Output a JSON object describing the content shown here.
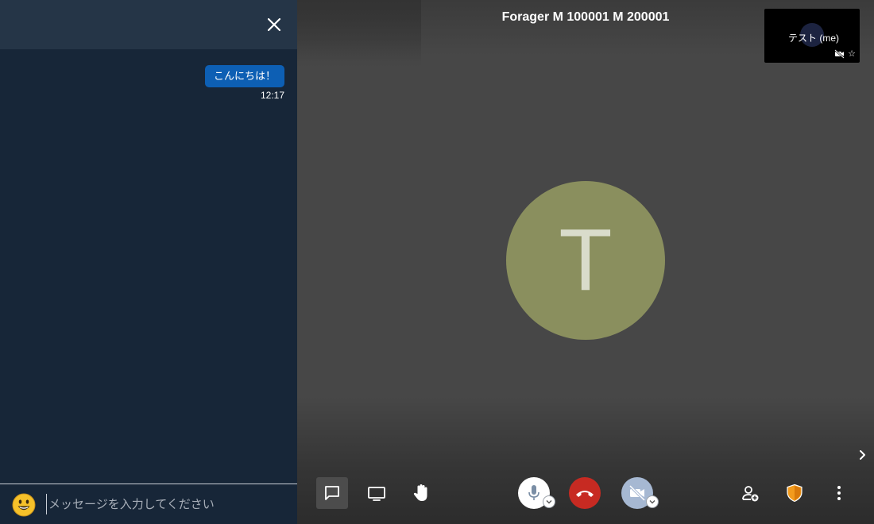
{
  "chat": {
    "messages": [
      {
        "text": "こんにちは！",
        "time": "12:17"
      }
    ],
    "input_placeholder": "メッセージを入力してください"
  },
  "stage": {
    "meeting_title": "Forager M 100001 M 200001",
    "participant_initial": "T",
    "self_view_name": "テスト (me)"
  },
  "colors": {
    "chat_bg": "#172638",
    "chat_header_bg": "#253547",
    "bubble_bg": "#0d5fb4",
    "avatar_bg": "#8a8f5e",
    "hangup_red": "#c72a22",
    "security_orange": "#f29b1d"
  },
  "icons": {
    "close": "close-icon",
    "emoji": "smiley-emoji-icon",
    "chat": "chat-icon",
    "screen_share": "screen-share-icon",
    "raise_hand": "raise-hand-icon",
    "microphone": "microphone-icon",
    "hangup": "hangup-icon",
    "camera_off": "camera-off-icon",
    "invite": "add-person-icon",
    "security": "shield-icon",
    "more": "more-vertical-icon",
    "muted_camera": "muted-camera-icon",
    "star": "star-icon",
    "pane_toggle": "chevron-right-icon"
  }
}
